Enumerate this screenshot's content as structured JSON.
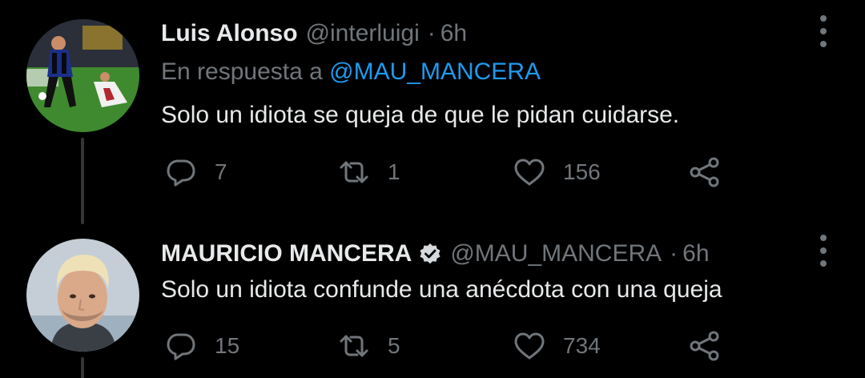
{
  "tweets": [
    {
      "author_name": "Luis Alonso",
      "handle": "@interluigi",
      "separator": "·",
      "time": "6h",
      "reply_prefix": "En respuesta a",
      "reply_mention": "@MAU_MANCERA",
      "text": "Solo un idiota se queja de que le pidan cuidarse.",
      "verified": false,
      "stats": {
        "replies": "7",
        "retweets": "1",
        "likes": "156"
      }
    },
    {
      "author_name": "MAURICIO MANCERA",
      "handle": "@MAU_MANCERA",
      "separator": "·",
      "time": "6h",
      "text": "Solo un idiota confunde una anécdota con una queja",
      "verified": true,
      "stats": {
        "replies": "15",
        "retweets": "5",
        "likes": "734"
      }
    }
  ],
  "icons": {
    "reply": "reply-icon",
    "retweet": "retweet-icon",
    "like": "heart-icon",
    "share": "share-icon",
    "more": "more-options-icon",
    "verified": "verified-badge-icon"
  },
  "colors": {
    "background": "#000000",
    "primary_text": "#e7e9ea",
    "secondary_text": "#71767b",
    "link": "#1d9bf0",
    "thread_line": "#333639"
  }
}
